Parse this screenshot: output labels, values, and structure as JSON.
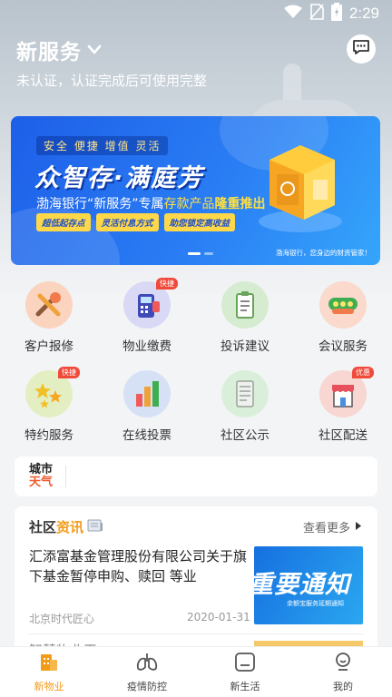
{
  "status_bar": {
    "time": "2:29"
  },
  "header": {
    "title": "新服务",
    "subtitle": "未认证，认证完成后可使用完整"
  },
  "banner": {
    "tags": "安全 便捷 增值 灵活",
    "headline": "众智存·满庭芳",
    "sub_prefix": "渤海银行“新服务”专属",
    "sub_accent": "存款产品",
    "sub_highlight": "隆重推出",
    "chips": [
      "超低起存点",
      "灵活付息方式",
      "助您锁定高收益"
    ],
    "slogan": "渤海银行，您身边的财资管家！"
  },
  "services": [
    {
      "label": "客户报修",
      "icon": "wrench-icon",
      "badge": "",
      "color": "#f07a4a"
    },
    {
      "label": "物业缴费",
      "icon": "payment-terminal-icon",
      "badge": "快捷",
      "color": "#6b6fd6"
    },
    {
      "label": "投诉建议",
      "icon": "clipboard-icon",
      "badge": "",
      "color": "#72b85c"
    },
    {
      "label": "会议服务",
      "icon": "meeting-icon",
      "badge": "",
      "color": "#4fbf6a"
    },
    {
      "label": "特约服务",
      "icon": "stars-icon",
      "badge": "快捷",
      "color": "#a6c24a"
    },
    {
      "label": "在线投票",
      "icon": "bar-chart-icon",
      "badge": "",
      "color": "#f0a23a"
    },
    {
      "label": "社区公示",
      "icon": "document-icon",
      "badge": "",
      "color": "#9fb3a6"
    },
    {
      "label": "社区配送",
      "icon": "shop-icon",
      "badge": "优惠",
      "color": "#e8505b"
    }
  ],
  "weather": {
    "logo_line1": "城市",
    "logo_line2": "天气"
  },
  "news": {
    "heading_prefix": "社区",
    "heading_accent": "资讯",
    "more": "查看更多",
    "items": [
      {
        "title": "汇添富基金管理股份有限公司关于旗下基金暂停申购、赎回 等业",
        "source": "北京时代匠心",
        "date": "2020-01-31",
        "thumb_big": "重要通知",
        "thumb_small": "余额宝服务延期通知"
      },
      {
        "title": "智慧物业平...",
        "source": "",
        "date": ""
      }
    ]
  },
  "bottom_nav": [
    {
      "label": "新物业",
      "icon": "building-icon",
      "active": true
    },
    {
      "label": "疫情防控",
      "icon": "lungs-icon",
      "active": false
    },
    {
      "label": "新生活",
      "icon": "home-icon",
      "active": false
    },
    {
      "label": "我的",
      "icon": "user-icon",
      "active": false
    }
  ],
  "colors": {
    "accent": "#f29b18",
    "banner_blue": "#1d5fe8"
  }
}
